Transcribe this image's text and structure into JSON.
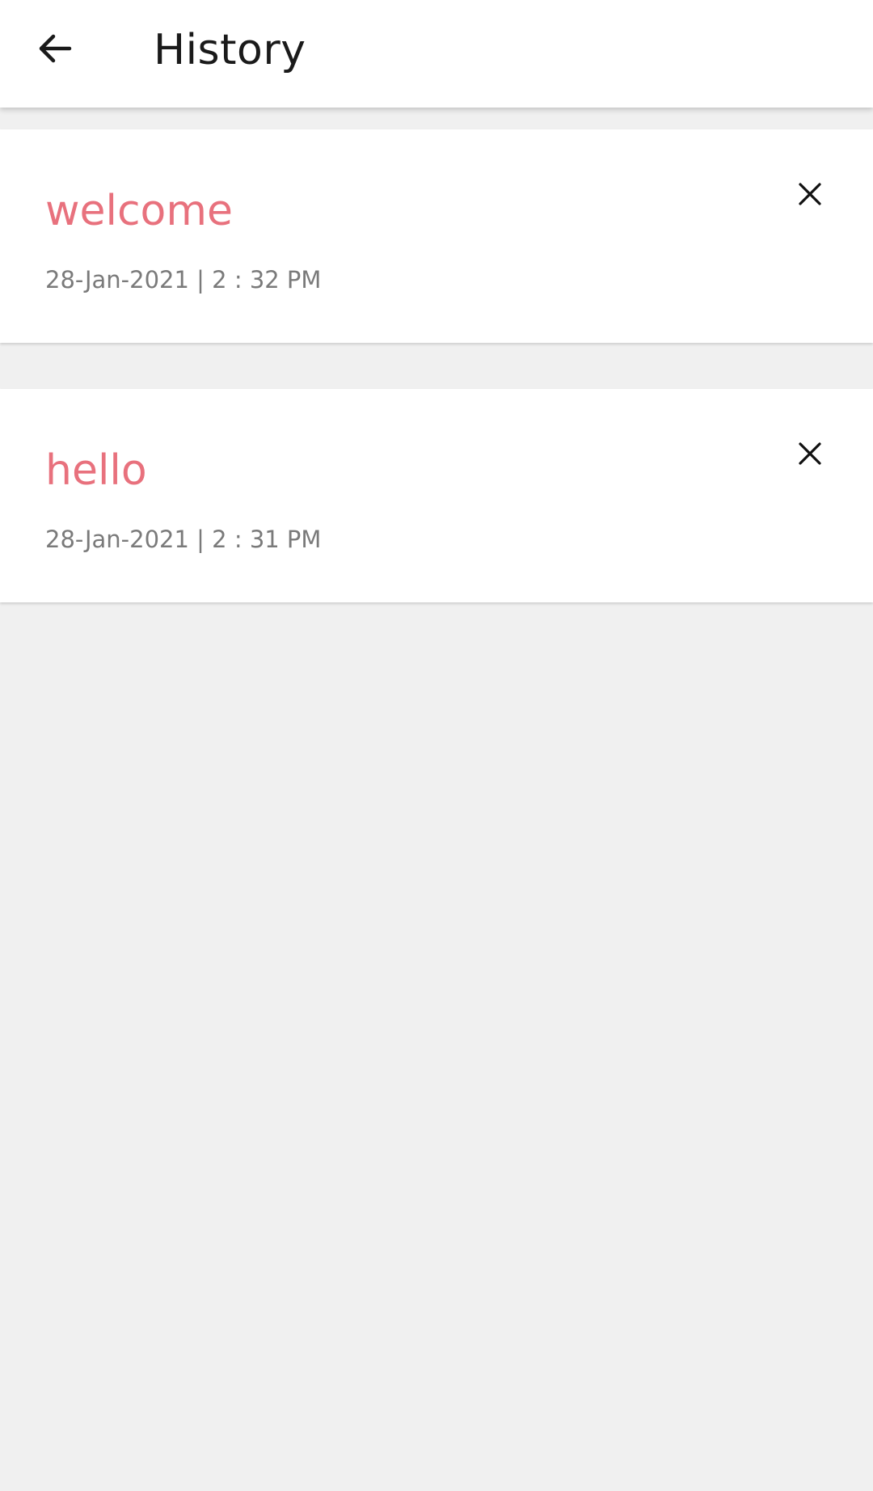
{
  "app_bar": {
    "title": "History",
    "back_icon": "arrow-left-icon"
  },
  "history": {
    "items": [
      {
        "text": "welcome",
        "datetime": "28-Jan-2021 | 2 : 32 PM",
        "close_icon": "close-icon"
      },
      {
        "text": "hello",
        "datetime": "28-Jan-2021 | 2 : 31 PM",
        "close_icon": "close-icon"
      }
    ]
  },
  "colors": {
    "accent_text": "#e8717d",
    "date_text": "#7a7a7a",
    "background": "#f0f0f0",
    "card": "#ffffff"
  }
}
